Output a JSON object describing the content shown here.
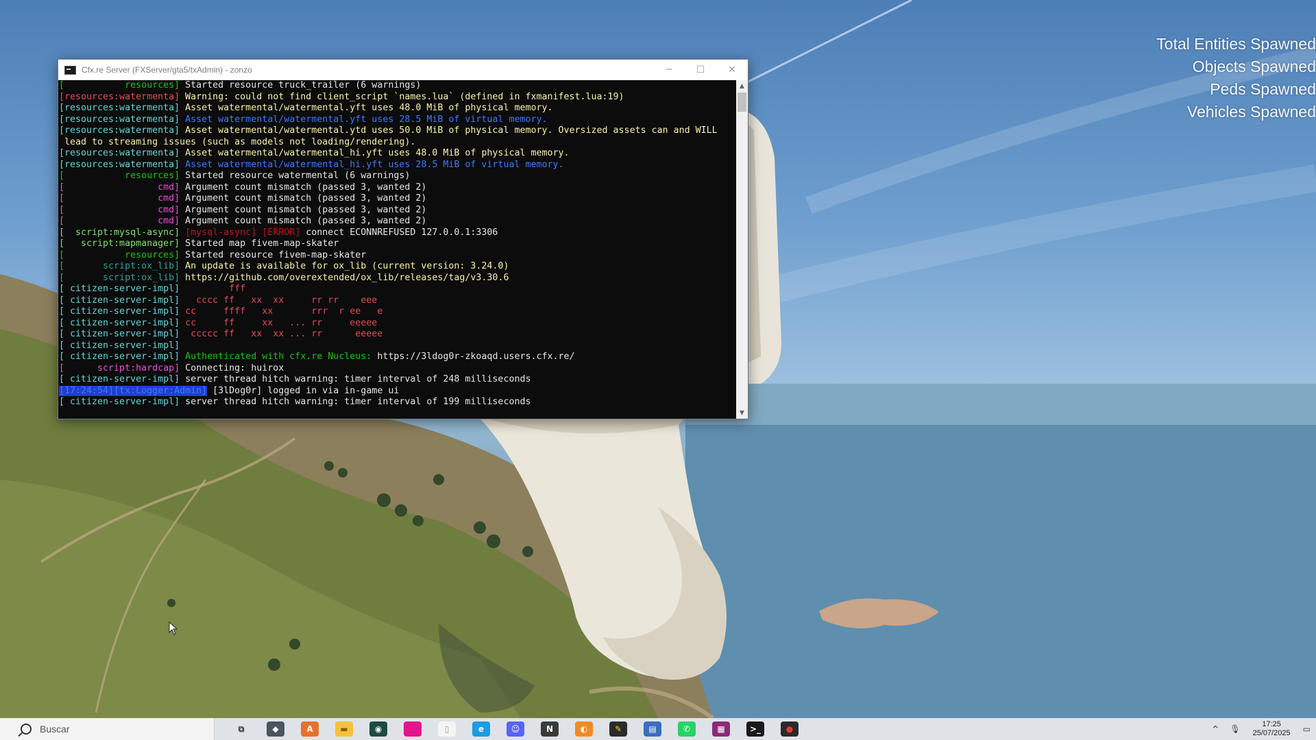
{
  "hud": {
    "lines": [
      "Total Entities Spawned",
      "Objects Spawned",
      "Peds Spawned",
      "Vehicles Spawned"
    ]
  },
  "window": {
    "title": "Cfx.re Server (FXServer/gta5/txAdmin) - zonzo",
    "minimize": "─",
    "maximize": "☐",
    "close": "✕"
  },
  "console": {
    "lines": [
      [
        {
          "t": "[           resources] ",
          "c": "c-green"
        },
        {
          "t": "Started resource truck_trailer (6 warnings)",
          "c": "c-white"
        }
      ],
      [
        {
          "t": "[resources:watermenta] ",
          "c": "c-red"
        },
        {
          "t": "Warning: could not find client_script `names.lua` (defined in fxmanifest.lua:19)",
          "c": "c-yellow"
        }
      ],
      [
        {
          "t": "[resources:watermenta] ",
          "c": "c-cyan"
        },
        {
          "t": "Asset watermental/watermental.yft uses 48.0 MiB of physical memory.",
          "c": "c-yellow"
        }
      ],
      [
        {
          "t": "[resources:watermenta] ",
          "c": "c-cyan"
        },
        {
          "t": "Asset watermental/watermental.yft uses 28.5 MiB of virtual memory.",
          "c": "c-blue"
        }
      ],
      [
        {
          "t": "[resources:watermenta] ",
          "c": "c-cyan"
        },
        {
          "t": "Asset watermental/watermental.ytd uses 50.0 MiB of physical memory. Oversized assets can and WILL",
          "c": "c-yellow"
        }
      ],
      [
        {
          "t": " lead to streaming issues (such as models not loading/rendering).",
          "c": "c-yellow"
        }
      ],
      [
        {
          "t": "[resources:watermenta] ",
          "c": "c-cyan"
        },
        {
          "t": "Asset watermental/watermental_hi.yft uses 48.0 MiB of physical memory.",
          "c": "c-yellow"
        }
      ],
      [
        {
          "t": "[resources:watermenta] ",
          "c": "c-cyan"
        },
        {
          "t": "Asset watermental/watermental_hi.yft uses 28.5 MiB of virtual memory.",
          "c": "c-blue"
        }
      ],
      [
        {
          "t": "[           resources] ",
          "c": "c-green"
        },
        {
          "t": "Started resource watermental (6 warnings)",
          "c": "c-white"
        }
      ],
      [
        {
          "t": "[                 cmd] ",
          "c": "c-pink"
        },
        {
          "t": "Argument count mismatch (passed 3, wanted 2)",
          "c": "c-white"
        }
      ],
      [
        {
          "t": "[                 cmd] ",
          "c": "c-pink"
        },
        {
          "t": "Argument count mismatch (passed 3, wanted 2)",
          "c": "c-white"
        }
      ],
      [
        {
          "t": "[                 cmd] ",
          "c": "c-pink"
        },
        {
          "t": "Argument count mismatch (passed 3, wanted 2)",
          "c": "c-white"
        }
      ],
      [
        {
          "t": "[                 cmd] ",
          "c": "c-pink"
        },
        {
          "t": "Argument count mismatch (passed 3, wanted 2)",
          "c": "c-white"
        }
      ],
      [
        {
          "t": "[  script:mysql-async] ",
          "c": "c-lgreen"
        },
        {
          "t": "[mysql-async] [ERROR] ",
          "c": "c-dred"
        },
        {
          "t": "connect ECONNREFUSED 127.0.0.1:3306",
          "c": "c-white"
        }
      ],
      [
        {
          "t": "[   script:mapmanager] ",
          "c": "c-lgreen"
        },
        {
          "t": "Started map fivem-map-skater",
          "c": "c-white"
        }
      ],
      [
        {
          "t": "[           resources] ",
          "c": "c-green"
        },
        {
          "t": "Started resource fivem-map-skater",
          "c": "c-white"
        }
      ],
      [
        {
          "t": "[       script:ox_lib] ",
          "c": "c-teal"
        },
        {
          "t": "An update is available for ox_lib (current version: 3.24.0)",
          "c": "c-yellow"
        }
      ],
      [
        {
          "t": "[       script:ox_lib] ",
          "c": "c-teal"
        },
        {
          "t": "https://github.com/overextended/ox_lib/releases/tag/v3.30.6",
          "c": "c-yellow"
        }
      ],
      [
        {
          "t": "[ citizen-server-impl] ",
          "c": "c-cyan"
        },
        {
          "t": "        fff",
          "c": "c-red"
        }
      ],
      [
        {
          "t": "[ citizen-server-impl] ",
          "c": "c-cyan"
        },
        {
          "t": "  cccc ff   xx  xx     rr rr    eee",
          "c": "c-red"
        }
      ],
      [
        {
          "t": "[ citizen-server-impl] ",
          "c": "c-cyan"
        },
        {
          "t": "cc     ffff   xx       rrr  r ee   e",
          "c": "c-red"
        }
      ],
      [
        {
          "t": "[ citizen-server-impl] ",
          "c": "c-cyan"
        },
        {
          "t": "cc     ff     xx   ... rr     eeeee",
          "c": "c-red"
        }
      ],
      [
        {
          "t": "[ citizen-server-impl] ",
          "c": "c-cyan"
        },
        {
          "t": " ccccc ff   xx  xx ... rr      eeeee",
          "c": "c-red"
        }
      ],
      [
        {
          "t": "[ citizen-server-impl] ",
          "c": "c-cyan"
        }
      ],
      [
        {
          "t": "[ citizen-server-impl] ",
          "c": "c-cyan"
        },
        {
          "t": "Authenticated with cfx.re Nucleus: ",
          "c": "c-green"
        },
        {
          "t": "https://3ldog0r-zkoaqd.users.cfx.re/",
          "c": "c-white"
        }
      ],
      [
        {
          "t": "[      script:hardcap] ",
          "c": "c-pink"
        },
        {
          "t": "Connecting: huirox",
          "c": "c-white"
        }
      ],
      [
        {
          "t": "[ citizen-server-impl] ",
          "c": "c-cyan"
        },
        {
          "t": "server thread hitch warning: timer interval of 248 milliseconds",
          "c": "c-white"
        }
      ],
      [
        {
          "t": "[17:24:54][tx:Logger:Admin]",
          "c": "c-hl"
        },
        {
          "t": " [3lDog0r] logged in via in-game ui",
          "c": "c-white"
        }
      ],
      [
        {
          "t": "[ citizen-server-impl] ",
          "c": "c-cyan"
        },
        {
          "t": "server thread hitch warning: timer interval of 199 milliseconds",
          "c": "c-white"
        }
      ]
    ]
  },
  "scrollbar": {
    "up": "▲",
    "down": "▼"
  },
  "taskbar": {
    "search_placeholder": "Buscar",
    "apps": [
      {
        "name": "task-view",
        "label": "⧉",
        "color": "#dfe3e8",
        "fg": "#333"
      },
      {
        "name": "app-game",
        "label": "◆",
        "color": "#4a5560",
        "fg": "#fff"
      },
      {
        "name": "app-orange",
        "label": "A",
        "color": "#e8702a",
        "fg": "#fff"
      },
      {
        "name": "file-explorer",
        "label": "▬",
        "color": "#f3c13a",
        "fg": "#8a5a00"
      },
      {
        "name": "app-dark",
        "label": "◉",
        "color": "#1c4b43",
        "fg": "#fff"
      },
      {
        "name": "app-pink",
        "label": "■",
        "color": "#e5148b",
        "fg": "#e5148b"
      },
      {
        "name": "app-doc",
        "label": "▯",
        "color": "#f5f5f5",
        "fg": "#999"
      },
      {
        "name": "edge",
        "label": "e",
        "color": "#1b9de2",
        "fg": "#fff"
      },
      {
        "name": "discord",
        "label": "☺",
        "color": "#5865f2",
        "fg": "#fff"
      },
      {
        "name": "app-n",
        "label": "N",
        "color": "#3a3a3a",
        "fg": "#fff"
      },
      {
        "name": "blender",
        "label": "◐",
        "color": "#f08a24",
        "fg": "#fff"
      },
      {
        "name": "app-note",
        "label": "✎",
        "color": "#2b2b2b",
        "fg": "#f7d417"
      },
      {
        "name": "app-chart",
        "label": "▤",
        "color": "#3c6dbf",
        "fg": "#fff"
      },
      {
        "name": "whatsapp",
        "label": "✆",
        "color": "#25d366",
        "fg": "#fff"
      },
      {
        "name": "app-winrar",
        "label": "▦",
        "color": "#8a2a7a",
        "fg": "#fff"
      },
      {
        "name": "terminal",
        "label": ">_",
        "color": "#1a1a1a",
        "fg": "#fff"
      },
      {
        "name": "app-red",
        "label": "●",
        "color": "#2a2a2a",
        "fg": "#e33"
      }
    ],
    "clock_time": "17:25",
    "clock_date": "25/07/2025"
  }
}
